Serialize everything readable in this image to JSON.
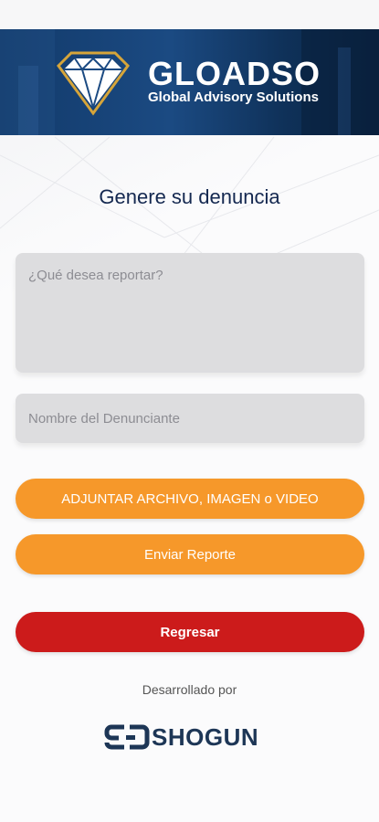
{
  "header": {
    "brand_name": "GLOADSO",
    "brand_tagline": "Global Advisory Solutions",
    "logo_icon": "diamond-icon"
  },
  "form": {
    "title": "Genere su denuncia",
    "report_placeholder": "¿Qué desea reportar?",
    "report_value": "",
    "name_placeholder": "Nombre del Denunciante",
    "name_value": ""
  },
  "buttons": {
    "attach_label": "ADJUNTAR ARCHIVO, IMAGEN o VIDEO",
    "send_label": "Enviar Reporte",
    "back_label": "Regresar"
  },
  "footer": {
    "developed_by": "Desarrollado por",
    "company_name": "SHOGUN",
    "company_icon": "shogun-logo-icon"
  },
  "colors": {
    "banner": "#1b4a82",
    "title": "#142850",
    "orange_button": "#f6982a",
    "red_button": "#cc1b1b",
    "field_bg": "#dddddf",
    "shogun_text": "#1d3656"
  }
}
